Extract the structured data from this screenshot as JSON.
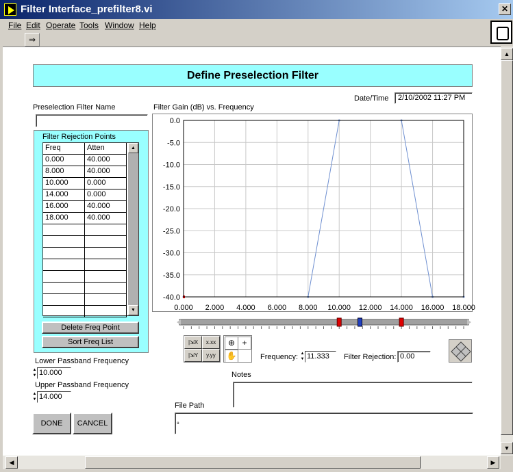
{
  "window": {
    "title": "Filter Interface_prefilter8.vi",
    "close_glyph": "✕"
  },
  "menu": [
    "File",
    "Edit",
    "Operate",
    "Tools",
    "Window",
    "Help"
  ],
  "toolbar": {
    "run_icon": "run-arrow-icon"
  },
  "banner": {
    "title": "Define Preselection Filter"
  },
  "datetime": {
    "label": "Date/Time",
    "value": "2/10/2002 11:27 PM"
  },
  "filter_name": {
    "label": "Preselection Filter Name",
    "value": ""
  },
  "rejection_points": {
    "title": "Filter Rejection Points",
    "columns": [
      "Freq",
      "Atten"
    ],
    "rows": [
      [
        "0.000",
        "40.000"
      ],
      [
        "8.000",
        "40.000"
      ],
      [
        "10.000",
        "0.000"
      ],
      [
        "14.000",
        "0.000"
      ],
      [
        "16.000",
        "40.000"
      ],
      [
        "18.000",
        "40.000"
      ]
    ],
    "empty_rows": 8
  },
  "buttons": {
    "delete_freq": "Delete Freq Point",
    "sort_freq": "Sort Freq List",
    "done": "DONE",
    "cancel": "CANCEL"
  },
  "passband": {
    "lower_label": "Lower Passband Frequency",
    "lower_value": "10.000",
    "upper_label": "Upper Passband Frequency",
    "upper_value": "14.000"
  },
  "cursor": {
    "frequency_label": "Frequency:",
    "frequency_value": "11.333",
    "rejection_label": "Filter Rejection:",
    "rejection_value": "0.00",
    "markers": [
      10.0,
      11.333,
      14.0
    ]
  },
  "palette": {
    "x_format": "x.xx",
    "y_format": "y.yy"
  },
  "notes": {
    "label": "Notes",
    "value": ""
  },
  "file_path": {
    "label": "File Path",
    "value": ""
  },
  "chart_data": {
    "type": "line",
    "title": "Filter Gain (dB) vs. Frequency",
    "x": [
      0,
      8,
      10,
      14,
      16,
      18
    ],
    "y": [
      -40,
      -40,
      0,
      0,
      -40,
      -40
    ],
    "xlim": [
      0,
      18
    ],
    "ylim": [
      -40,
      0
    ],
    "xticks": [
      "0.000",
      "2.000",
      "4.000",
      "6.000",
      "8.000",
      "10.000",
      "12.000",
      "14.000",
      "16.000",
      "18.000"
    ],
    "yticks": [
      "0.0",
      "-5.0",
      "-10.0",
      "-15.0",
      "-20.0",
      "-25.0",
      "-30.0",
      "-35.0",
      "-40.0"
    ],
    "grid": true,
    "line_color": "#6e8fd0",
    "marker_color": "#e00000"
  }
}
